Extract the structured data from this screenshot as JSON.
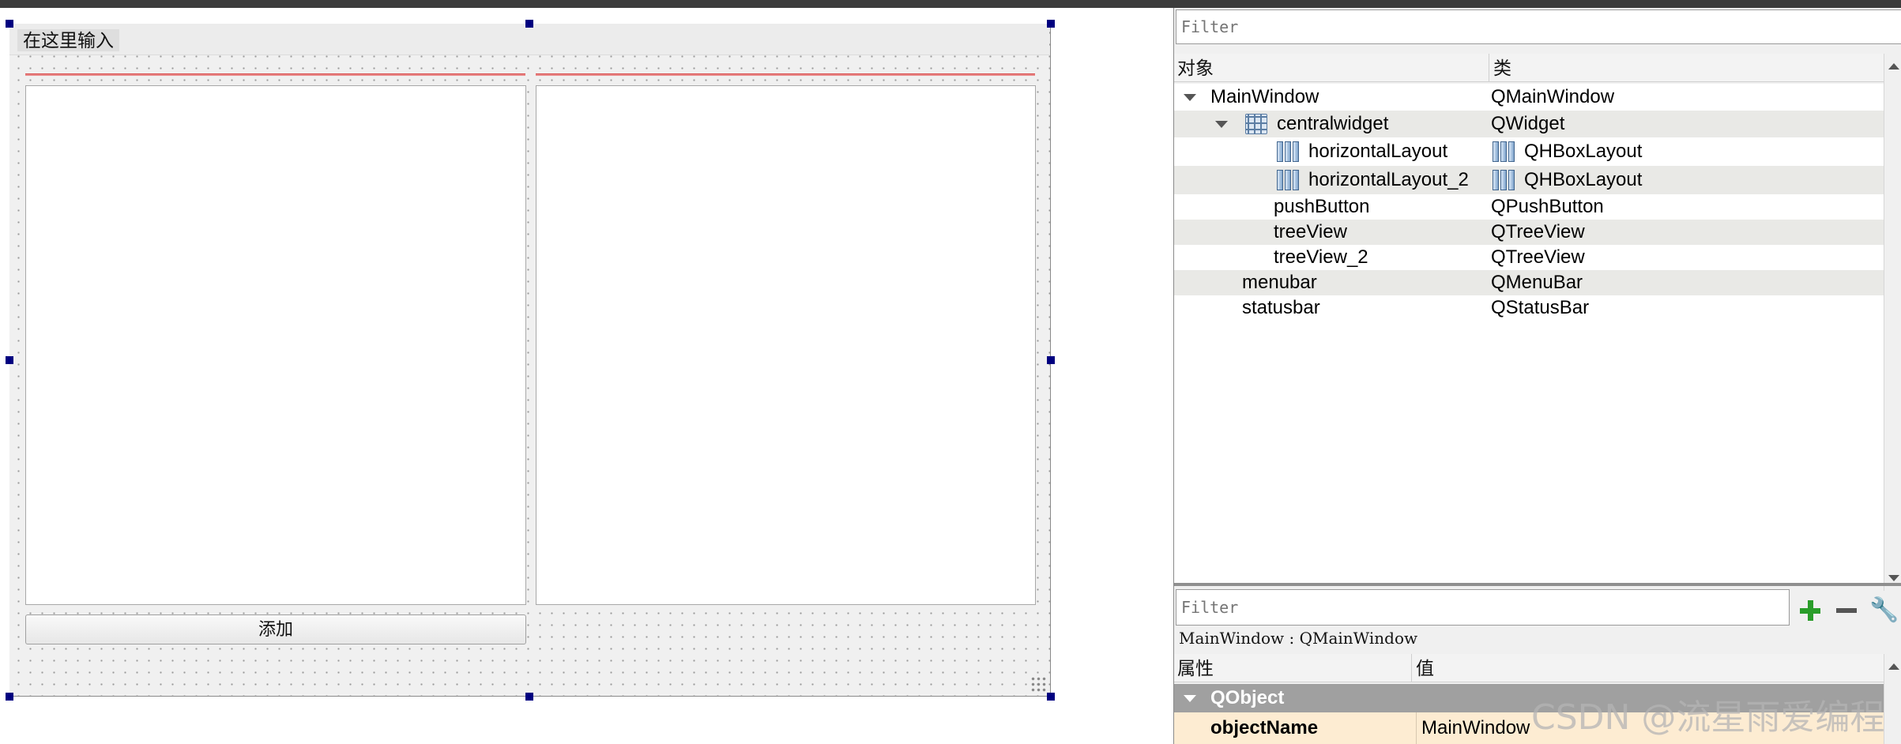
{
  "canvas": {
    "menu_placeholder": "在这里输入",
    "push_button_label": "添加"
  },
  "object_inspector": {
    "filter_placeholder": "Filter",
    "header_object": "对象",
    "header_class": "类",
    "rows": [
      {
        "name": "MainWindow",
        "class": "QMainWindow",
        "expanded": true,
        "icon": "none"
      },
      {
        "name": "centralwidget",
        "class": "QWidget",
        "expanded": true,
        "icon": "grid-layout-icon"
      },
      {
        "name": "horizontalLayout",
        "class": "QHBoxLayout",
        "icon": "hbox-layout-icon"
      },
      {
        "name": "horizontalLayout_2",
        "class": "QHBoxLayout",
        "icon": "hbox-layout-icon"
      },
      {
        "name": "pushButton",
        "class": "QPushButton",
        "icon": "none"
      },
      {
        "name": "treeView",
        "class": "QTreeView",
        "icon": "none"
      },
      {
        "name": "treeView_2",
        "class": "QTreeView",
        "icon": "none"
      },
      {
        "name": "menubar",
        "class": "QMenuBar",
        "icon": "none"
      },
      {
        "name": "statusbar",
        "class": "QStatusBar",
        "icon": "none"
      }
    ]
  },
  "property_editor": {
    "filter_placeholder": "Filter",
    "caption": "MainWindow : QMainWindow",
    "header_property": "属性",
    "header_value": "值",
    "group": "QObject",
    "property_name": "objectName",
    "property_value": "MainWindow"
  },
  "watermark": "CSDN @流星雨爱编程",
  "colors": {
    "selection_handle": "#000080",
    "red_layout_line": "#d94a4a",
    "add_icon": "#2a9d2a",
    "group_header": "#a0a0a0",
    "property_row": "#fdecd2"
  }
}
